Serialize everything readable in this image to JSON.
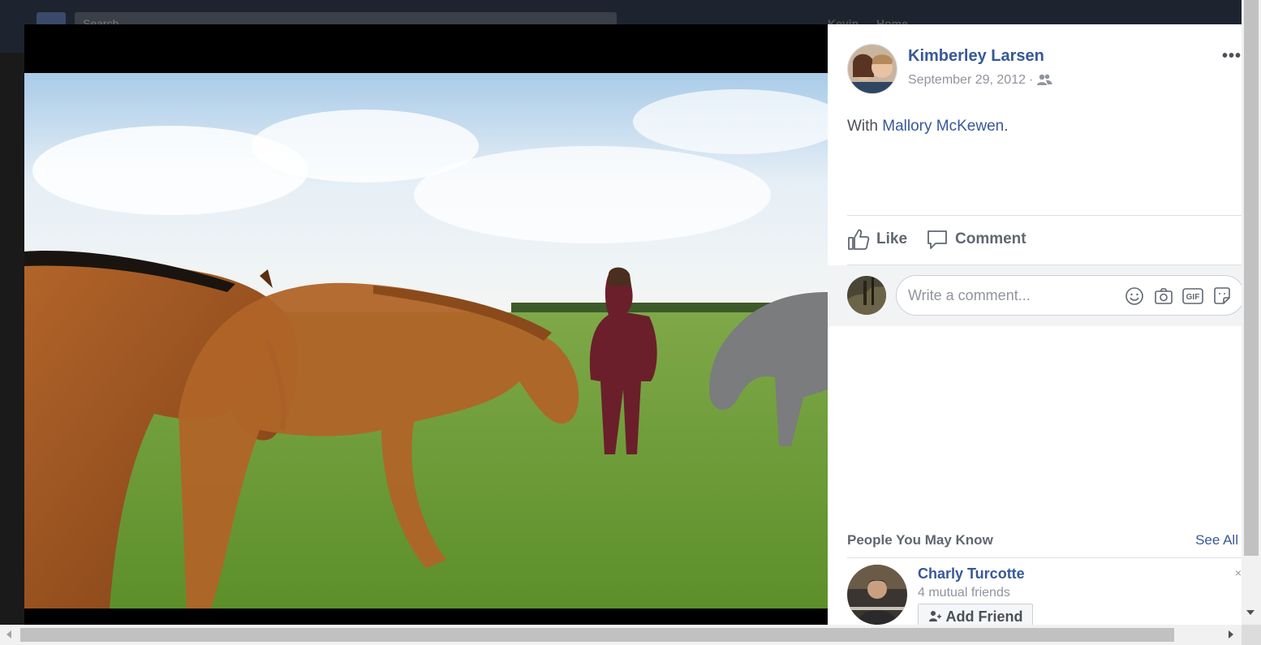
{
  "header": {
    "search_placeholder": "Search",
    "user_name": "Kevin",
    "home_label": "Home"
  },
  "post": {
    "author": "Kimberley Larsen",
    "date": "September 29, 2012",
    "separator": "·",
    "audience_icon": "friends-icon",
    "more_label": "•••",
    "caption_prefix": "With",
    "tagged_person": "Mallory McKewen",
    "caption_suffix": "."
  },
  "actions": {
    "like_label": "Like",
    "comment_label": "Comment"
  },
  "comment": {
    "placeholder": "Write a comment...",
    "icons": [
      "emoji-icon",
      "camera-icon",
      "gif-icon",
      "sticker-icon"
    ],
    "gif_label": "GIF"
  },
  "pymk": {
    "title": "People You May Know",
    "see_all": "See All",
    "person": {
      "name": "Charly Turcotte",
      "mutual": "4 mutual friends",
      "add_label": "Add Friend",
      "close_label": "×"
    }
  },
  "colors": {
    "link": "#385898",
    "muted": "#90949c",
    "text": "#4b4f56"
  }
}
